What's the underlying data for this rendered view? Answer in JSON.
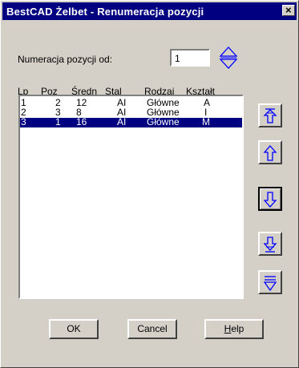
{
  "window": {
    "title": "BestCAD Żelbet - Renumeracja pozycji",
    "close_glyph": "×"
  },
  "numbering": {
    "label": "Numeracja pozycji od:",
    "value": "1"
  },
  "columns": [
    "Lp",
    "Poz",
    "Średn",
    "Stal",
    "Rodzaj",
    "Kształt"
  ],
  "rows": [
    {
      "lp": "1",
      "poz": "2",
      "sredn": "12",
      "stal": "AI",
      "rodzaj": "Główne",
      "ksztalt": "A",
      "selected": false
    },
    {
      "lp": "2",
      "poz": "3",
      "sredn": "8",
      "stal": "AI",
      "rodzaj": "Główne",
      "ksztalt": "I",
      "selected": false
    },
    {
      "lp": "3",
      "poz": "1",
      "sredn": "16",
      "stal": "AI",
      "rodzaj": "Główne",
      "ksztalt": "M",
      "selected": true
    }
  ],
  "side_buttons": [
    "move-top-icon",
    "move-up-icon",
    "move-down-icon",
    "move-bottom-icon",
    "move-last-icon"
  ],
  "buttons": {
    "ok": "OK",
    "cancel": "Cancel",
    "help_h": "H",
    "help_rest": "elp"
  },
  "colors": {
    "selection": "#000080",
    "titlebar": "#000080",
    "icon": "#0000ff"
  }
}
